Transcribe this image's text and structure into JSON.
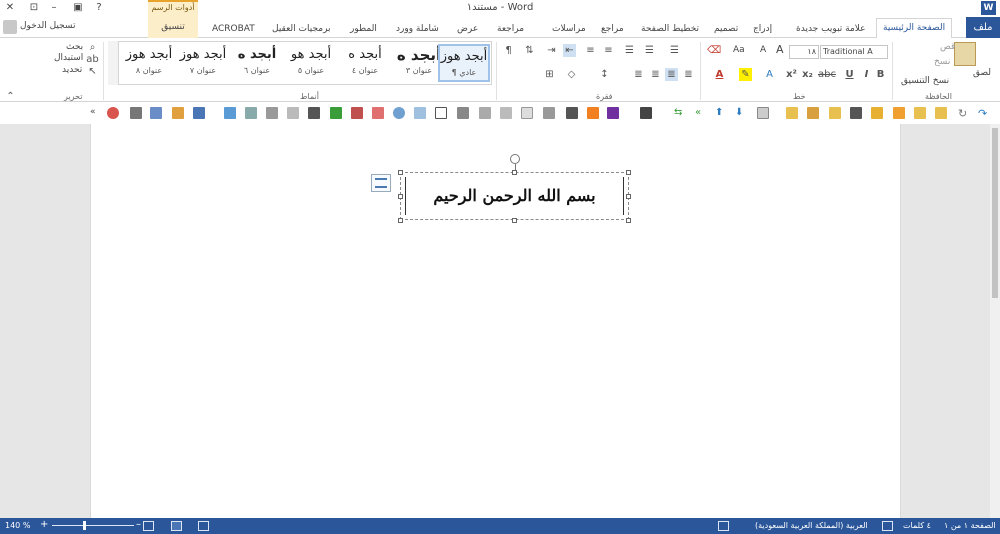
{
  "titlebar": {
    "title": "مستند١ - Word",
    "controls": [
      "✕",
      "⊡",
      "–",
      "▣",
      "?"
    ]
  },
  "tabs": {
    "file": "ملف",
    "home": "الصفحة الرئيسية",
    "items": [
      "علامة تبويب جديدة",
      "إدراج",
      "تصميم",
      "تخطيط الصفحة",
      "مراجع",
      "مراسلات",
      "مراجعة",
      "عرض",
      "شاملة وورد",
      "المطور",
      "برمجيات العقيل",
      "ACROBAT"
    ],
    "contextual_header": "أدوات الرسم",
    "contextual_tab": "تنسيق",
    "signin": "تسجيل الدخول"
  },
  "ribbon": {
    "clipboard": {
      "label": "الحافظة",
      "paste": "لصق",
      "cut": "قص",
      "copy": "نسخ",
      "format_painter": "نسخ التنسيق"
    },
    "font": {
      "label": "خط",
      "name": "Traditional A",
      "size": "١٨",
      "grow": "A",
      "shrink": "A",
      "change_case": "Aa"
    },
    "paragraph": {
      "label": "فقرة"
    },
    "styles": {
      "label": "أنماط",
      "items": [
        {
          "sample": "أبجد هوز",
          "name": "¶ عادي"
        },
        {
          "sample": "أبجد ه",
          "name": "عنوان ٣"
        },
        {
          "sample": "أبجد ه",
          "name": "عنوان ٤"
        },
        {
          "sample": "أبجد هو",
          "name": "عنوان ٥"
        },
        {
          "sample": "أبجد ه",
          "name": "عنوان ٦"
        },
        {
          "sample": "أبجد هوز",
          "name": "عنوان ٧"
        },
        {
          "sample": "أبجد هوز",
          "name": "عنوان ٨"
        }
      ]
    },
    "editing": {
      "label": "تحرير",
      "find": "بحث",
      "replace": "استبدال",
      "select": "تحديد"
    }
  },
  "document": {
    "textbox_text": "بسم الله الرحمن الرحيم"
  },
  "statusbar": {
    "page": "الصفحة ١ من ١",
    "words": "٤ كلمات",
    "language": "العربية (المملكة العربية السعودية)",
    "zoom": "140 %",
    "zoom_value": 140
  },
  "colors": {
    "accent": "#2b579a",
    "contextual": "#fdeeca",
    "contextual_border": "#e7a32c"
  }
}
